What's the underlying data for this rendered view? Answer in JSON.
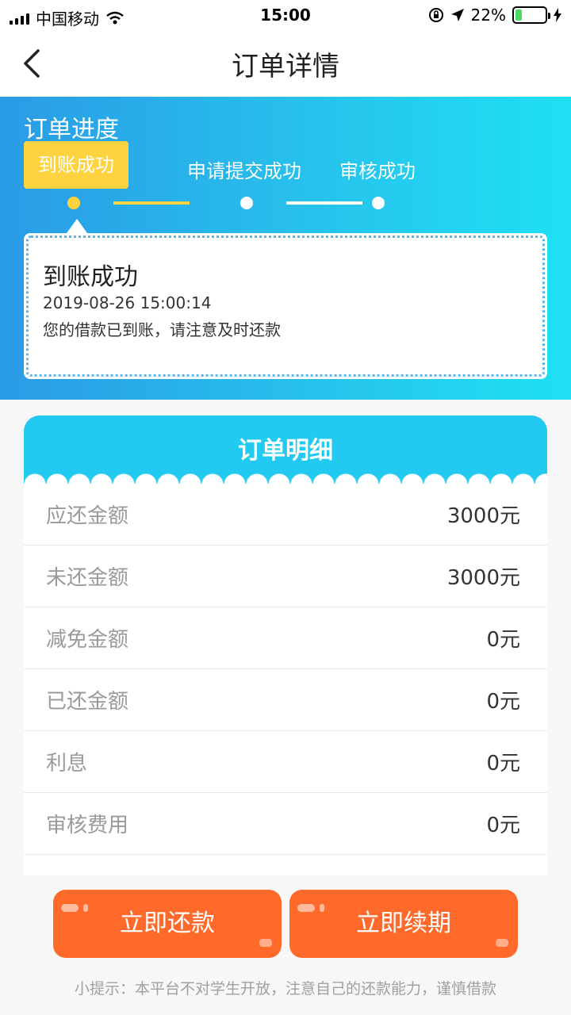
{
  "status_bar": {
    "carrier": "中国移动",
    "time": "15:00",
    "battery_percent": "22%",
    "battery_level": 0.22,
    "icons": [
      "signal-icon",
      "wifi-icon",
      "orientation-lock-icon",
      "location-icon",
      "battery-icon",
      "charging-icon"
    ]
  },
  "nav": {
    "title": "订单详情",
    "back_icon": "chevron-left-icon"
  },
  "progress": {
    "title": "订单进度",
    "steps": [
      {
        "label": "到账成功",
        "active": true
      },
      {
        "label": "申请提交成功",
        "active": false
      },
      {
        "label": "审核成功",
        "active": false
      }
    ],
    "detail": {
      "status": "到账成功",
      "time": "2019-08-26 15:00:14",
      "description": "您的借款已到账，请注意及时还款"
    },
    "colors": {
      "gradient_start": "#2a9be6",
      "gradient_end": "#1fe0f3",
      "active": "#ffd23f"
    }
  },
  "order": {
    "title": "订单明细",
    "rows": [
      {
        "label": "应还金额",
        "value": "3000元"
      },
      {
        "label": "未还金额",
        "value": "3000元"
      },
      {
        "label": "减免金额",
        "value": "0元"
      },
      {
        "label": "已还金额",
        "value": "0元"
      },
      {
        "label": "利息",
        "value": "0元"
      },
      {
        "label": "审核费用",
        "value": "0元"
      }
    ]
  },
  "actions": {
    "repay_label": "立即还款",
    "renew_label": "立即续期",
    "button_color": "#ff6a2a"
  },
  "tip": "小提示：本平台不对学生开放，注意自己的还款能力，谨慎借款"
}
